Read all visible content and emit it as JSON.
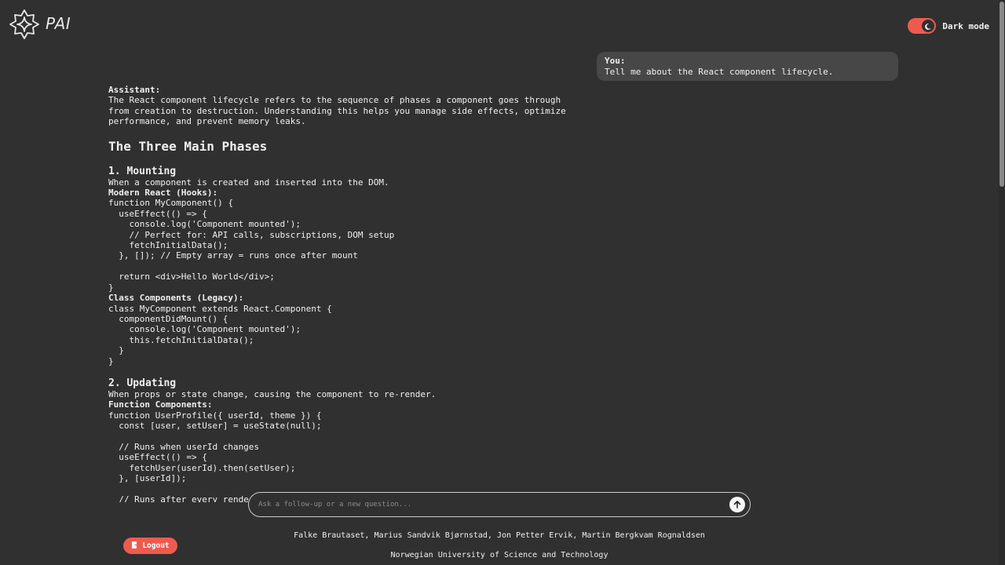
{
  "header": {
    "app_name": "PAI",
    "logo_icon": "sparkle-logo-icon",
    "dark_mode_label": "Dark mode",
    "dark_mode_on": true,
    "toggle_icon": "moon-icon"
  },
  "colors": {
    "accent": "#ef5a4f",
    "background": "#303030",
    "bubble": "#474747",
    "text": "#f0f0f0"
  },
  "user_message": {
    "role": "You:",
    "text": "Tell me about the React component lifecycle."
  },
  "assistant_message": {
    "role": "Assistant:",
    "intro": "The React component lifecycle refers to the sequence of phases a component goes through\nfrom creation to destruction. Understanding this helps you manage side effects, optimize\nperformance, and prevent memory leaks.",
    "heading": "The Three Main Phases",
    "mounting": {
      "title": "1. Mounting",
      "description": "When a component is created and inserted into the DOM.",
      "hooks_label": "Modern React (Hooks):",
      "hooks_code": "function MyComponent() {\n  useEffect(() => {\n    console.log('Component mounted');\n    // Perfect for: API calls, subscriptions, DOM setup\n    fetchInitialData();\n  }, []); // Empty array = runs once after mount\n\n  return <div>Hello World</div>;\n}",
      "class_label": "Class Components (Legacy):",
      "class_code": "class MyComponent extends React.Component {\n  componentDidMount() {\n    console.log('Component mounted');\n    this.fetchInitialData();\n  }\n}"
    },
    "updating": {
      "title": "2. Updating",
      "description": "When props or state change, causing the component to re-render.",
      "function_label": "Function Components:",
      "function_code": "function UserProfile({ userId, theme }) {\n  const [user, setUser] = useState(null);\n\n  // Runs when userId changes\n  useEffect(() => {\n    fetchUser(userId).then(setUser);\n  }, [userId]);\n\n  // Runs after every render"
    }
  },
  "input": {
    "placeholder": "Ask a follow-up or a new question...",
    "value": "",
    "send_icon": "arrow-up-icon"
  },
  "footer": {
    "logout_label": "Logout",
    "logout_icon": "logout-icon",
    "authors": "Falke Brautaset, Marius Sandvik Bjørnstad, Jon Petter Ervik, Martin Bergkvam Rognaldsen",
    "university": "Norwegian University of Science and Technology"
  }
}
